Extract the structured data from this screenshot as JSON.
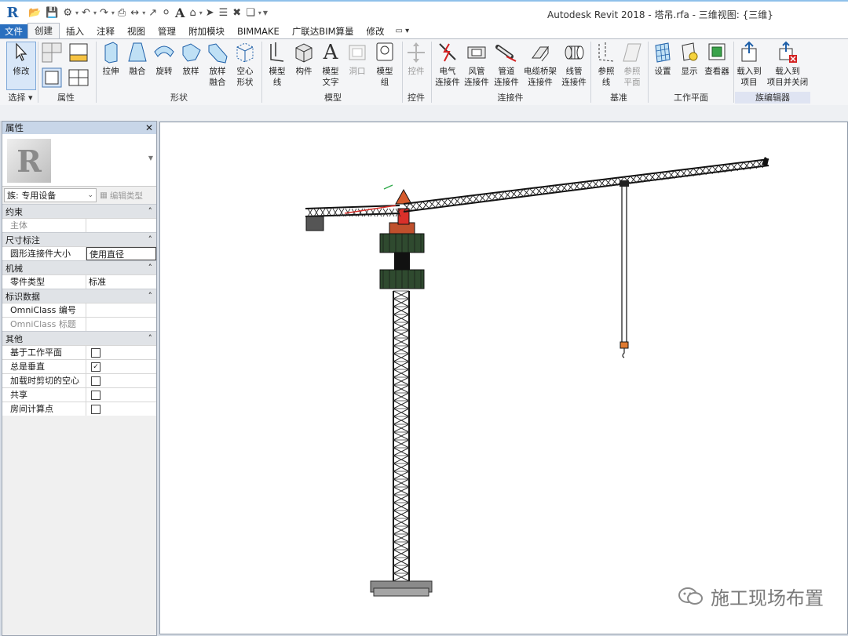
{
  "app": {
    "title": "Autodesk Revit 2018 -    塔吊.rfa - 三维视图: {三维}"
  },
  "tabs": {
    "file": "文件",
    "items": [
      "创建",
      "插入",
      "注释",
      "视图",
      "管理",
      "附加模块",
      "BIMMAKE",
      "广联达BIM算量",
      "修改"
    ]
  },
  "ribbon": {
    "select": {
      "label": "修改",
      "group": "选择"
    },
    "properties_group": "属性",
    "forms": {
      "extrude": "拉伸",
      "blend": "融合",
      "revolve": "旋转",
      "sweep": "放样",
      "swept_blend_1": "放样",
      "swept_blend_2": "融合",
      "void_1": "空心",
      "void_2": "形状",
      "group": "形状"
    },
    "model": {
      "line_1": "模型",
      "line_2": "线",
      "component": "构件",
      "text_1": "模型",
      "text_2": "文字",
      "opening": "洞口",
      "group_1": "模型",
      "group_2": "组",
      "group": "模型"
    },
    "control": {
      "label": "控件",
      "group": "控件"
    },
    "connectors": {
      "electrical_1": "电气",
      "electrical_2": "连接件",
      "duct_1": "风管",
      "duct_2": "连接件",
      "pipe_1": "管道",
      "pipe_2": "连接件",
      "tray_1": "电缆桥架",
      "tray_2": "连接件",
      "conduit_1": "线管",
      "conduit_2": "连接件",
      "group": "连接件"
    },
    "datum": {
      "ref_line_1": "参照",
      "ref_line_2": "线",
      "ref_plane_1": "参照",
      "ref_plane_2": "平面",
      "group": "基准"
    },
    "workplane": {
      "set": "设置",
      "show": "显示",
      "viewer": "查看器",
      "group": "工作平面"
    },
    "family_editor": {
      "load_1": "载入到",
      "load_2": "项目",
      "load_close_1": "载入到",
      "load_close_2": "项目并关闭",
      "group": "族编辑器"
    }
  },
  "properties": {
    "title": "属性",
    "family": "族: 专用设备",
    "edit_type": "编辑类型",
    "sections": [
      {
        "name": "约束",
        "rows": [
          {
            "name": "主体",
            "value": "",
            "grey": true
          }
        ]
      },
      {
        "name": "尺寸标注",
        "rows": [
          {
            "name": "圆形连接件大小",
            "value": "使用直径"
          }
        ]
      },
      {
        "name": "机械",
        "rows": [
          {
            "name": "零件类型",
            "value": "标准"
          }
        ]
      },
      {
        "name": "标识数据",
        "rows": [
          {
            "name": "OmniClass 编号",
            "value": ""
          },
          {
            "name": "OmniClass 标题",
            "value": "",
            "grey": true
          }
        ]
      },
      {
        "name": "其他",
        "rows": [
          {
            "name": "基于工作平面",
            "checked": false
          },
          {
            "name": "总是垂直",
            "checked": true
          },
          {
            "name": "加载时剪切的空心",
            "checked": false
          },
          {
            "name": "共享",
            "checked": false
          },
          {
            "name": "房间计算点",
            "checked": false
          }
        ]
      }
    ]
  },
  "watermark": "施工现场布置"
}
